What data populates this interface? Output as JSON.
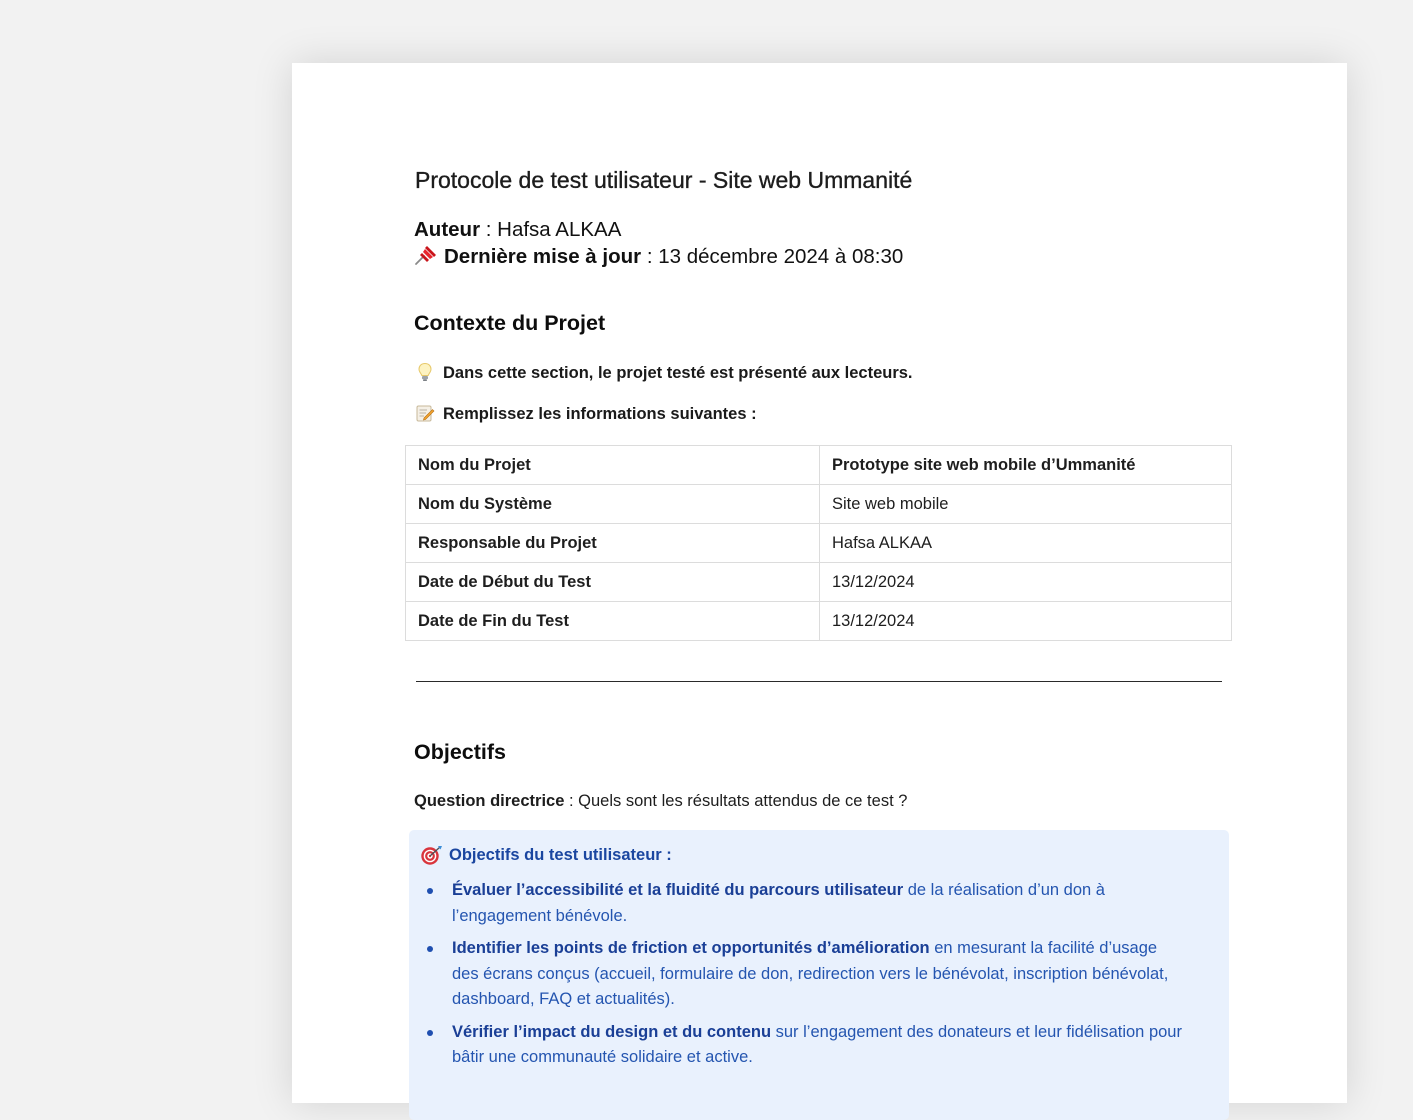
{
  "document": {
    "title": "Protocole de test utilisateur - Site web Ummanité",
    "author_label": "Auteur",
    "author_sep": " : ",
    "author_value": "Hafsa ALKAA",
    "update_icon": "pushpin-icon",
    "update_label": "Dernière mise à jour",
    "update_sep": " : ",
    "update_value": "13 décembre 2024 à 08:30"
  },
  "context": {
    "heading": "Contexte du Projet",
    "note1_icon": "lightbulb-icon",
    "note1": "Dans cette section, le projet testé est présenté aux lecteurs.",
    "note2_icon": "memo-icon",
    "note2": "Remplissez les informations suivantes :",
    "table": [
      {
        "key": "Nom du Projet",
        "value": "Prototype site web mobile d’Ummanité"
      },
      {
        "key": "Nom du Système",
        "value": "Site web mobile"
      },
      {
        "key": "Responsable du Projet",
        "value": "Hafsa ALKAA"
      },
      {
        "key": "Date de Début du Test",
        "value": "13/12/2024"
      },
      {
        "key": "Date de Fin du Test",
        "value": "13/12/2024"
      }
    ]
  },
  "objectives": {
    "heading": "Objectifs",
    "question_label": "Question directrice",
    "question_text": " : Quels sont les résultats attendus de ce test ?",
    "callout_icon": "target-icon",
    "callout_title": "Objectifs du test utilisateur :",
    "items": [
      {
        "strong": "Évaluer l’accessibilité et la fluidité du parcours utilisateur",
        "rest": " de la réalisation d’un don à l’engagement bénévole."
      },
      {
        "strong": "Identifier les points de friction et opportunités d’amélioration",
        "rest": " en mesurant la facilité d’usage des écrans conçus (accueil, formulaire de don, redirection vers le bénévolat, inscription bénévolat, dashboard, FAQ et actualités)."
      },
      {
        "strong": "Vérifier l’impact du design et du contenu",
        "rest": " sur l’engagement des donateurs et leur fidélisation pour bâtir une communauté solidaire et active."
      }
    ]
  },
  "colors": {
    "background": "#f2f2f2",
    "paper": "#ffffff",
    "callout_bg": "#e9f1fd",
    "callout_text": "#2455b0",
    "callout_strong": "#1a3f96"
  }
}
